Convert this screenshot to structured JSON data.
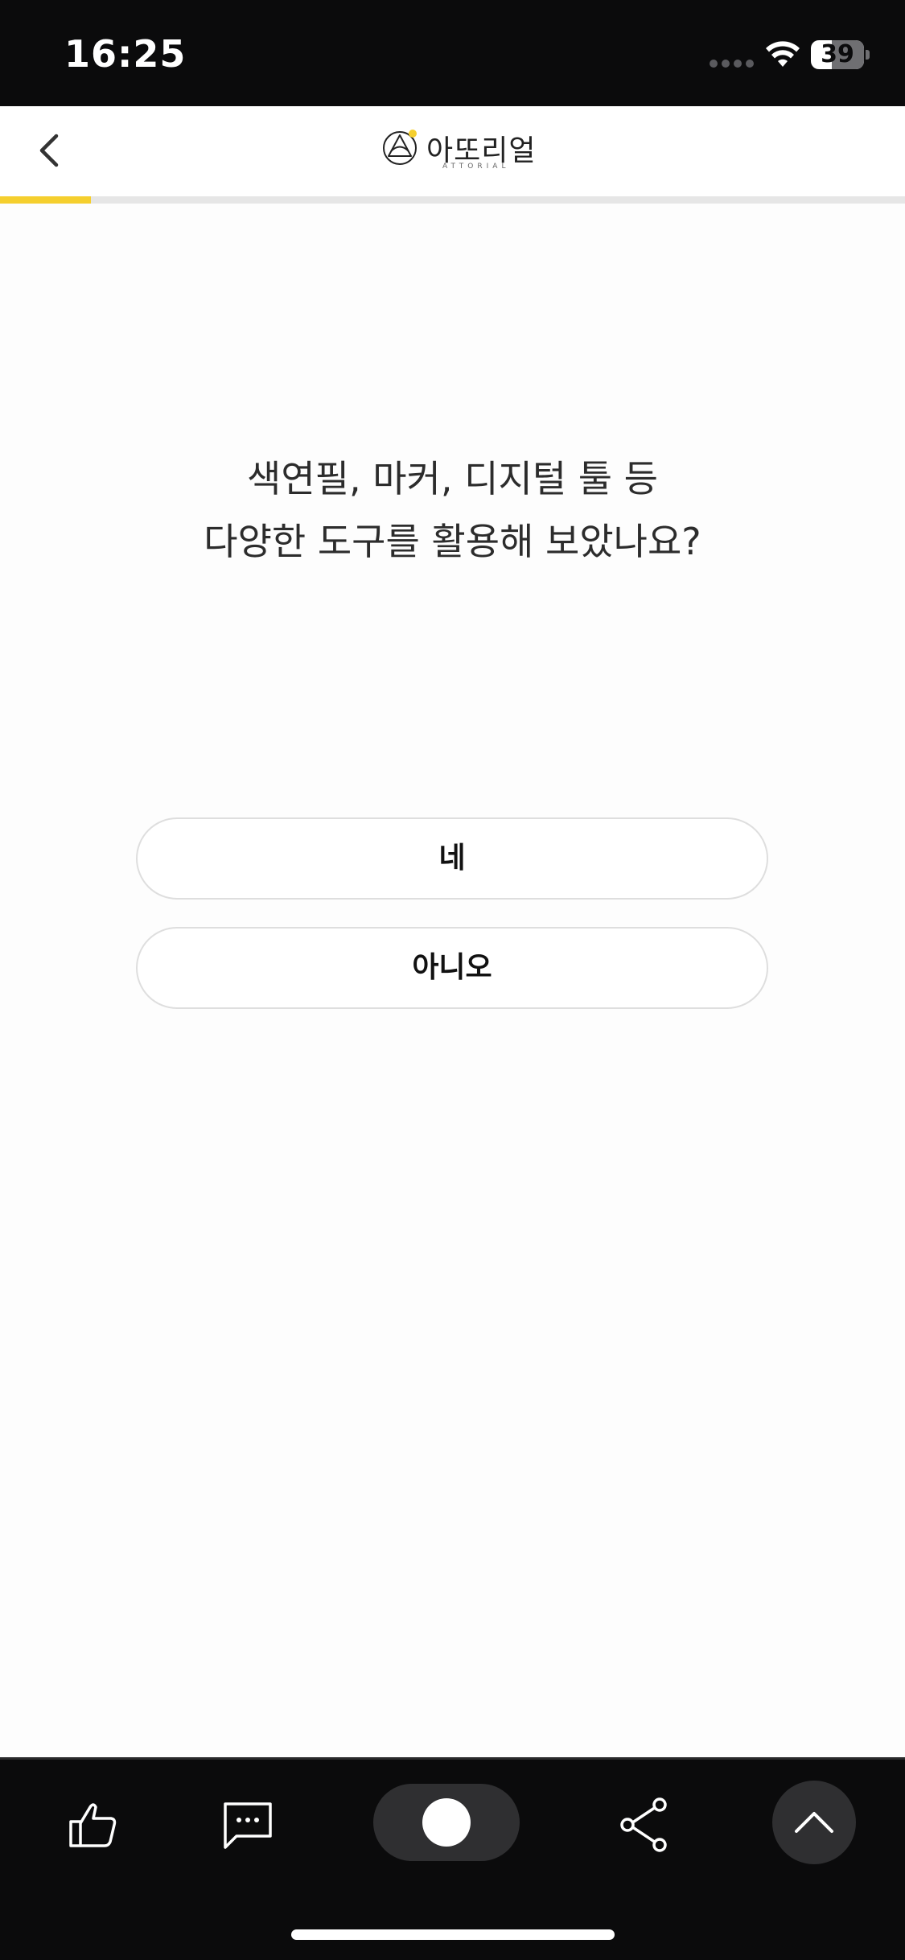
{
  "status_bar": {
    "time": "16:25",
    "battery_level": "39",
    "icons": [
      "signal-dots-icon",
      "wifi-icon",
      "battery-icon"
    ]
  },
  "header": {
    "back_icon": "chevron-left-icon",
    "logo_text": "아또리얼",
    "logo_subtext": "ATTORIAL",
    "progress": 0.1,
    "progress_color": "#f5cf2e"
  },
  "question": {
    "line1": "색연필, 마커, 디지털 툴 등",
    "line2": "다양한 도구를 활용해 보았나요?"
  },
  "answers": [
    {
      "label": "네"
    },
    {
      "label": "아니오"
    }
  ],
  "bottom_bar": {
    "icons": [
      "thumbs-up-icon",
      "comment-icon",
      "toggle-icon",
      "share-icon",
      "chevron-up-icon"
    ]
  },
  "colors": {
    "accent": "#f5cf2e",
    "background": "#fdfdfd",
    "bar_background": "#0b0b0c"
  }
}
